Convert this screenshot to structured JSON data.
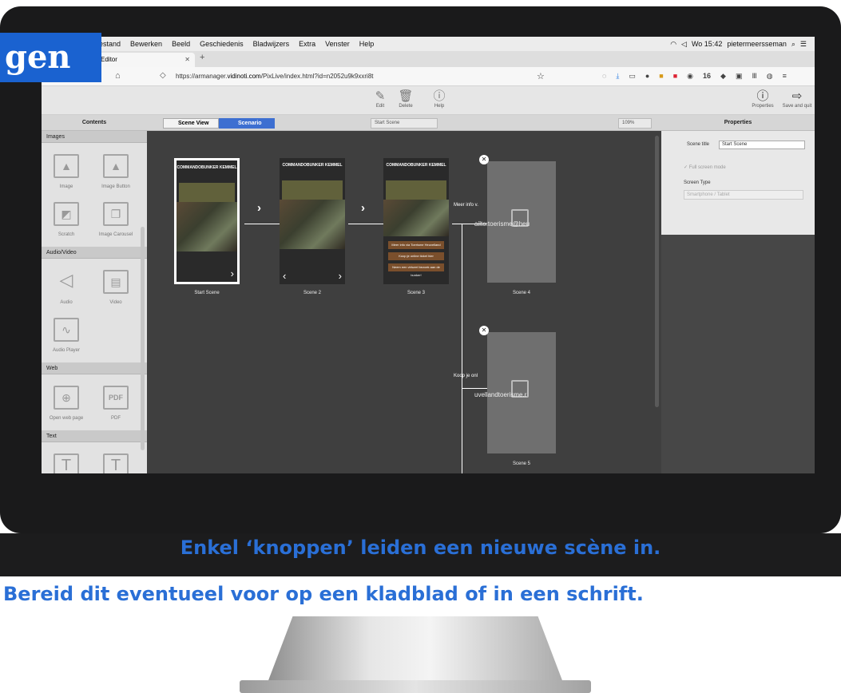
{
  "overlay": {
    "badge": "gen",
    "caption_line1": "Enkel ‘knoppen’ leiden een nieuwe scène in.",
    "caption_line2": "Bereid dit eventueel voor op een kladblad of in een schrift."
  },
  "menubar": {
    "items": [
      "estand",
      "Bewerken",
      "Beeld",
      "Geschiedenis",
      "Bladwijzers",
      "Extra",
      "Venster",
      "Help"
    ],
    "clock": "Wo 15:42",
    "user": "pietermeersseman"
  },
  "browser": {
    "tab_title": "Editor",
    "url_prefix": "https://armanager.",
    "url_domain": "vidinoti.com",
    "url_path": "/PixLive/index.html?id=n2052u9k9xxri8t",
    "ext_badge": "16"
  },
  "toolbar": {
    "edit": "Edit",
    "delete": "Delete",
    "help": "Help",
    "properties": "Properties",
    "save_and_quit": "Save and quit"
  },
  "panels": {
    "contents": "Contents",
    "scene_view": "Scene View",
    "scenario": "Scenario",
    "scene_select": "Start Scene",
    "zoom": "109%",
    "properties": "Properties"
  },
  "palette": {
    "images": "Images",
    "image": "Image",
    "image_button": "Image Button",
    "scratch": "Scratch",
    "image_carousel": "Image Carousel",
    "audio_video": "Audio/Video",
    "audio": "Audio",
    "video": "Video",
    "audio_player": "Audio Player",
    "web": "Web",
    "open_web_page": "Open web page",
    "pdf": "PDF",
    "pdf_icon_text": "PDF",
    "text": "Text"
  },
  "canvas": {
    "phone_title": "COMMANDOBUNKER KEMMEL",
    "scene_names": [
      "Start Scene",
      "Scene 2",
      "Scene 3",
      "Scene 4",
      "Scene 5"
    ],
    "btn_more_info": "Meer info via Toerisme Heuvelland",
    "btn_buy_ticket": "Koop je online ticket hier",
    "btn_virtual_visit": "Neem een virtueel bezoek aan de bunker!",
    "link_meer_info": "Meer info v.",
    "link_koop": "Koop je onl",
    "url_scene4": "ailto:toerisme@heu",
    "url_scene5": "uvellandtoerisme.r"
  },
  "properties": {
    "scene_title_label": "Scene title",
    "scene_title_value": "Start Scene",
    "full_screen_mode": "Full screen mode",
    "screen_type_label": "Screen Type",
    "screen_type_value": "Smartphone / Tablet"
  }
}
